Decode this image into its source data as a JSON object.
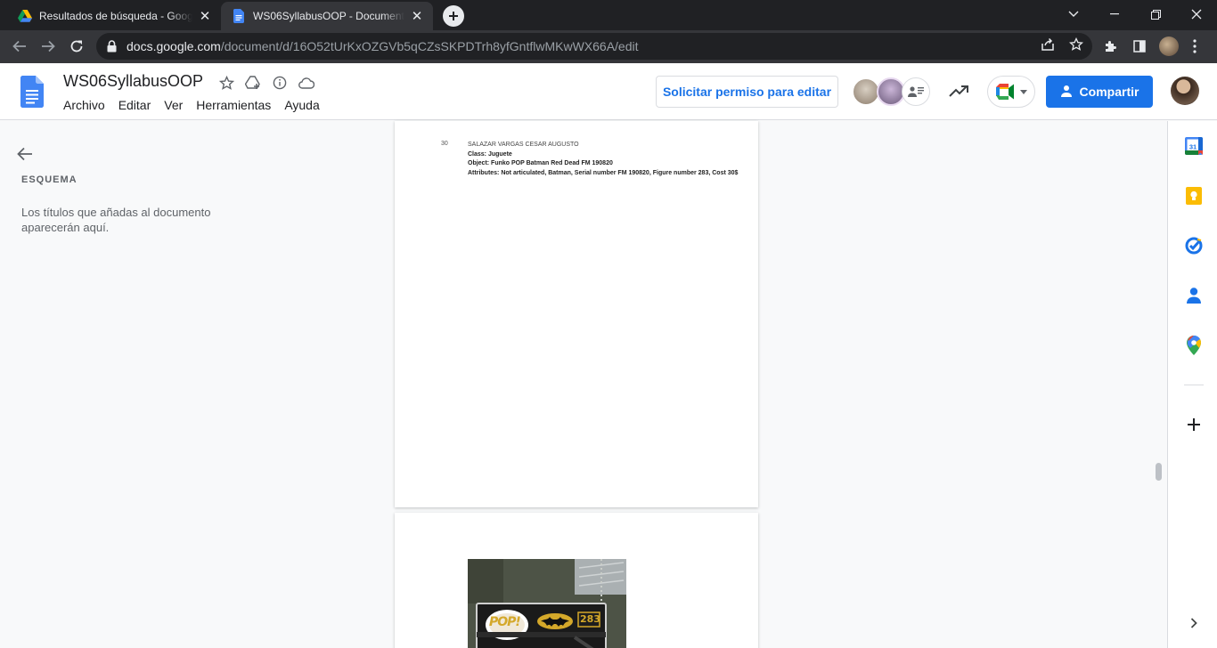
{
  "browser": {
    "tabs": [
      {
        "title": "Resultados de búsqueda - Google Drive",
        "icon": "google-drive-icon",
        "active": false
      },
      {
        "title": "WS06SyllabusOOP - Documentos de Google",
        "icon": "google-docs-icon",
        "active": true
      }
    ],
    "url_host": "docs.google.com",
    "url_path": "/document/d/16O52tUrKxOZGVb5qCZsSKPDTrh8yfGntflwMKwWX66A/edit"
  },
  "docs": {
    "title": "WS06SyllabusOOP",
    "menu": [
      "Archivo",
      "Editar",
      "Ver",
      "Herramientas",
      "Ayuda"
    ],
    "request_edit_label": "Solicitar permiso para editar",
    "share_label": "Compartir",
    "accent": "#1a73e8"
  },
  "outline": {
    "title": "ESQUEMA",
    "empty_text": "Los títulos que añadas al documento aparecerán aquí."
  },
  "document": {
    "entry": {
      "number": "30",
      "name": "SALAZAR VARGAS CESAR AUGUSTO",
      "class_line": "Class: Juguete",
      "object_line": "Object: Funko POP Batman Red Dead FM 190820",
      "attributes_line": "Attributes: Not articulated, Batman, Serial number FM 190820, Figure number 283, Cost 30$"
    },
    "photo_box_text": {
      "logo": "POP!",
      "figure_number": "283"
    }
  }
}
